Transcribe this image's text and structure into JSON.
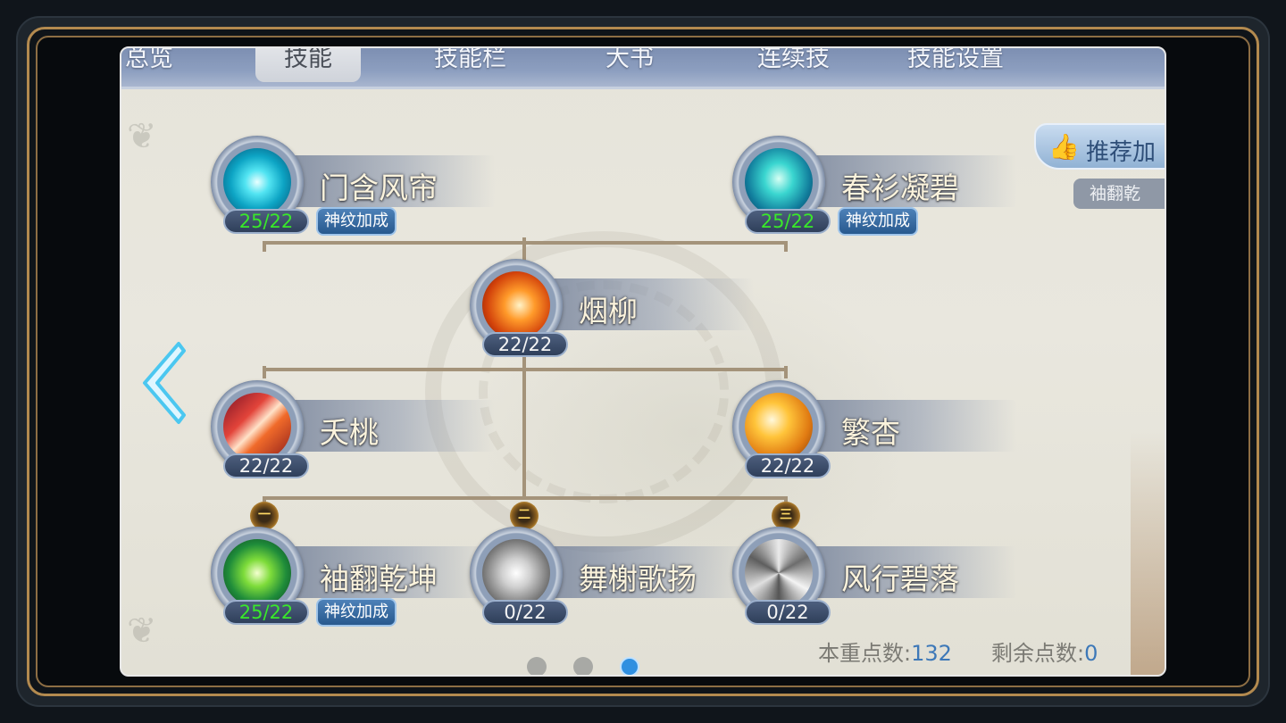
{
  "tabs": [
    {
      "label": "总览",
      "active": false
    },
    {
      "label": "技能",
      "active": true
    },
    {
      "label": "技能栏",
      "active": false
    },
    {
      "label": "大书",
      "active": false
    },
    {
      "label": "连续技",
      "active": false
    },
    {
      "label": "技能设置",
      "active": false
    }
  ],
  "skills": {
    "menhan": {
      "name": "门含风帘",
      "level": "25/22",
      "badge": "神纹加成"
    },
    "chunshan": {
      "name": "春衫凝碧",
      "level": "25/22",
      "badge": "神纹加成"
    },
    "yanliu": {
      "name": "烟柳",
      "level": "22/22"
    },
    "tiantao": {
      "name": "夭桃",
      "level": "22/22"
    },
    "fanxing": {
      "name": "繁杏",
      "level": "22/22"
    },
    "xiufan": {
      "name": "袖翻乾坤",
      "level": "25/22",
      "badge": "神纹加成",
      "tier": "一"
    },
    "wuxie": {
      "name": "舞榭歌扬",
      "level": "0/22",
      "tier": "二"
    },
    "fengxing": {
      "name": "风行碧落",
      "level": "0/22",
      "tier": "三"
    }
  },
  "recommend": {
    "label": "推荐加",
    "sub": "袖翻乾",
    "icon": "thumbs-up-icon"
  },
  "points": {
    "total_label": "本重点数:",
    "total_value": "132",
    "remaining_label": "剩余点数:",
    "remaining_value": "0"
  },
  "pager": {
    "count": 3,
    "active_index": 2
  },
  "colors": {
    "accent": "#2f8fe0",
    "level_complete": "#39e82a",
    "frame_gold": "#b38a4f"
  }
}
